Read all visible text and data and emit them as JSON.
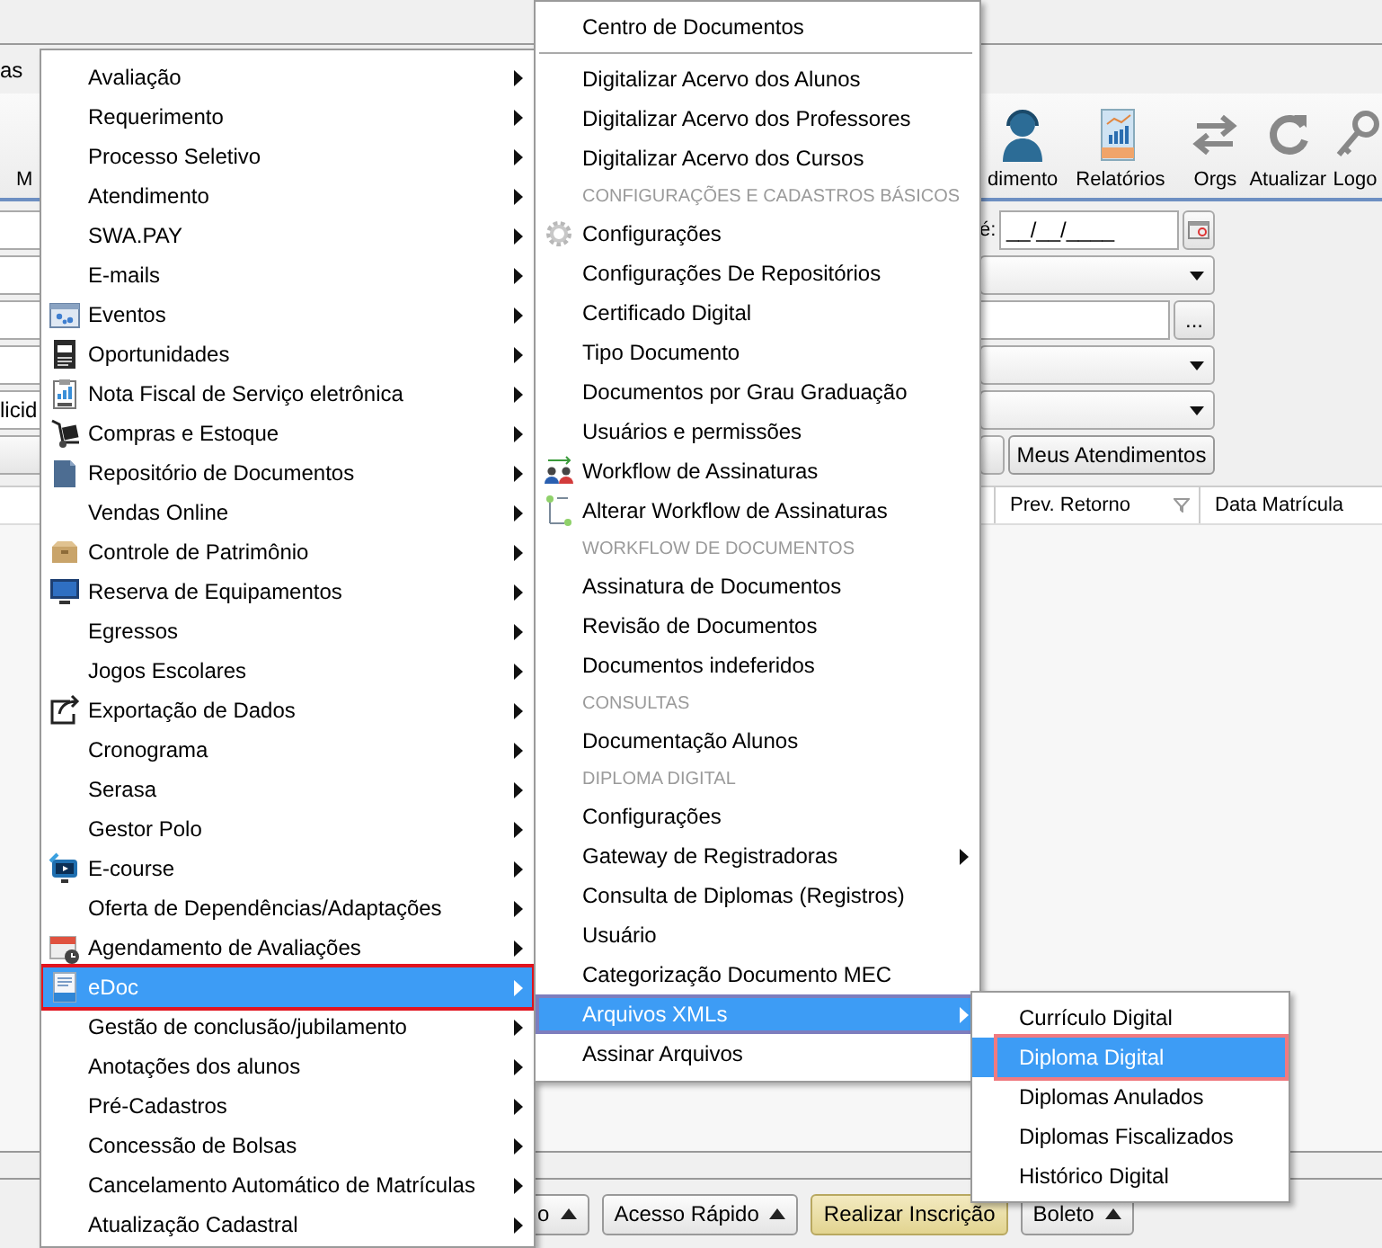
{
  "menu_bar": {
    "text": "as"
  },
  "toolbar": [
    {
      "label": "M"
    },
    {
      "label": "dimento"
    },
    {
      "label": "Relatórios"
    },
    {
      "label": "Orgs"
    },
    {
      "label": "Atualizar"
    },
    {
      "label": "Logo"
    }
  ],
  "form_rows": [
    {
      "kind": "date",
      "label": "é:",
      "value": "__/__/____"
    },
    {
      "kind": "dropdown"
    },
    {
      "kind": "lookup",
      "button": "..."
    },
    {
      "kind": "dropdown"
    },
    {
      "kind": "dropdown",
      "left_text": "licid"
    },
    {
      "kind": "buttons",
      "button": "Meus Atendimentos"
    }
  ],
  "table": {
    "columns": [
      {
        "label": "Prev. Retorno",
        "filter": true
      },
      {
        "label": "Data Matrícula",
        "filter": false
      }
    ]
  },
  "bottom_buttons": [
    {
      "label": "o",
      "kind": "menu"
    },
    {
      "label": "Acesso Rápido",
      "kind": "menu"
    },
    {
      "label": "Realizar Inscrição",
      "kind": "accent"
    },
    {
      "label": "Boleto",
      "kind": "menu"
    }
  ],
  "menus": [
    {
      "items": [
        {
          "kind": "item",
          "label": "Avaliação",
          "submenu": true,
          "selected": false,
          "marked": false
        },
        {
          "kind": "item",
          "label": "Requerimento",
          "submenu": true,
          "selected": false,
          "marked": false
        },
        {
          "kind": "item",
          "label": "Processo Seletivo",
          "submenu": true,
          "selected": false,
          "marked": false
        },
        {
          "kind": "item",
          "label": "Atendimento",
          "submenu": true,
          "selected": false,
          "marked": false
        },
        {
          "kind": "item",
          "label": "SWA.PAY",
          "submenu": true,
          "selected": false,
          "marked": false
        },
        {
          "kind": "item",
          "label": "E-mails",
          "submenu": true,
          "selected": false,
          "marked": false
        },
        {
          "kind": "item",
          "label": "Eventos",
          "submenu": true,
          "selected": false,
          "marked": false
        },
        {
          "kind": "item",
          "label": "Oportunidades",
          "submenu": true,
          "selected": false,
          "marked": false
        },
        {
          "kind": "item",
          "label": "Nota Fiscal de Serviço eletrônica",
          "submenu": true,
          "selected": false,
          "marked": false
        },
        {
          "kind": "item",
          "label": "Compras e Estoque",
          "submenu": true,
          "selected": false,
          "marked": false
        },
        {
          "kind": "item",
          "label": "Repositório de Documentos",
          "submenu": true,
          "selected": false,
          "marked": false
        },
        {
          "kind": "item",
          "label": "Vendas Online",
          "submenu": true,
          "selected": false,
          "marked": false
        },
        {
          "kind": "item",
          "label": "Controle de Patrimônio",
          "submenu": true,
          "selected": false,
          "marked": false
        },
        {
          "kind": "item",
          "label": "Reserva de Equipamentos",
          "submenu": true,
          "selected": false,
          "marked": false
        },
        {
          "kind": "item",
          "label": "Egressos",
          "submenu": true,
          "selected": false,
          "marked": false
        },
        {
          "kind": "item",
          "label": "Jogos Escolares",
          "submenu": true,
          "selected": false,
          "marked": false
        },
        {
          "kind": "item",
          "label": "Exportação de Dados",
          "submenu": true,
          "selected": false,
          "marked": false
        },
        {
          "kind": "item",
          "label": "Cronograma",
          "submenu": true,
          "selected": false,
          "marked": false
        },
        {
          "kind": "item",
          "label": "Serasa",
          "submenu": true,
          "selected": false,
          "marked": false
        },
        {
          "kind": "item",
          "label": "Gestor Polo",
          "submenu": true,
          "selected": false,
          "marked": false
        },
        {
          "kind": "item",
          "label": "E-course",
          "submenu": true,
          "selected": false,
          "marked": false
        },
        {
          "kind": "item",
          "label": "Oferta de Dependências/Adaptações",
          "submenu": true,
          "selected": false,
          "marked": false
        },
        {
          "kind": "item",
          "label": "Agendamento de Avaliações",
          "submenu": true,
          "selected": false,
          "marked": false
        },
        {
          "kind": "item",
          "label": "eDoc",
          "submenu": true,
          "selected": true,
          "marked": true
        },
        {
          "kind": "item",
          "label": "Gestão de conclusão/jubilamento",
          "submenu": true,
          "selected": false,
          "marked": false
        },
        {
          "kind": "item",
          "label": "Anotações dos alunos",
          "submenu": true,
          "selected": false,
          "marked": false
        },
        {
          "kind": "item",
          "label": "Pré-Cadastros",
          "submenu": true,
          "selected": false,
          "marked": false
        },
        {
          "kind": "item",
          "label": "Concessão de Bolsas",
          "submenu": true,
          "selected": false,
          "marked": false
        },
        {
          "kind": "item",
          "label": "Cancelamento Automático de Matrículas",
          "submenu": true,
          "selected": false,
          "marked": false
        },
        {
          "kind": "item",
          "label": "Atualização Cadastral",
          "submenu": true,
          "selected": false,
          "marked": false
        }
      ]
    },
    {
      "items": [
        {
          "kind": "item",
          "label": "Centro de Documentos",
          "submenu": false,
          "selected": false,
          "marked": false
        },
        {
          "kind": "separator"
        },
        {
          "kind": "item",
          "label": "Digitalizar Acervo dos Alunos",
          "submenu": false,
          "selected": false,
          "marked": false
        },
        {
          "kind": "item",
          "label": "Digitalizar Acervo dos Professores",
          "submenu": false,
          "selected": false,
          "marked": false
        },
        {
          "kind": "item",
          "label": "Digitalizar Acervo dos Cursos",
          "submenu": false,
          "selected": false,
          "marked": false
        },
        {
          "kind": "header",
          "label": "CONFIGURAÇÕES E CADASTROS BÁSICOS"
        },
        {
          "kind": "item",
          "label": "Configurações",
          "submenu": false,
          "selected": false,
          "marked": false
        },
        {
          "kind": "item",
          "label": "Configurações De Repositórios",
          "submenu": false,
          "selected": false,
          "marked": false
        },
        {
          "kind": "item",
          "label": "Certificado Digital",
          "submenu": false,
          "selected": false,
          "marked": false
        },
        {
          "kind": "item",
          "label": "Tipo Documento",
          "submenu": false,
          "selected": false,
          "marked": false
        },
        {
          "kind": "item",
          "label": "Documentos por Grau Graduação",
          "submenu": false,
          "selected": false,
          "marked": false
        },
        {
          "kind": "item",
          "label": "Usuários e permissões",
          "submenu": false,
          "selected": false,
          "marked": false
        },
        {
          "kind": "item",
          "label": "Workflow de Assinaturas",
          "submenu": false,
          "selected": false,
          "marked": false
        },
        {
          "kind": "item",
          "label": "Alterar Workflow de Assinaturas",
          "submenu": false,
          "selected": false,
          "marked": false
        },
        {
          "kind": "header",
          "label": "WORKFLOW DE DOCUMENTOS"
        },
        {
          "kind": "item",
          "label": "Assinatura de Documentos",
          "submenu": false,
          "selected": false,
          "marked": false
        },
        {
          "kind": "item",
          "label": "Revisão de Documentos",
          "submenu": false,
          "selected": false,
          "marked": false
        },
        {
          "kind": "item",
          "label": "Documentos indeferidos",
          "submenu": false,
          "selected": false,
          "marked": false
        },
        {
          "kind": "header",
          "label": "CONSULTAS"
        },
        {
          "kind": "item",
          "label": "Documentação Alunos",
          "submenu": false,
          "selected": false,
          "marked": false
        },
        {
          "kind": "header",
          "label": "DIPLOMA DIGITAL"
        },
        {
          "kind": "item",
          "label": "Configurações",
          "submenu": false,
          "selected": false,
          "marked": false
        },
        {
          "kind": "item",
          "label": "Gateway de Registradoras",
          "submenu": true,
          "selected": false,
          "marked": false
        },
        {
          "kind": "item",
          "label": "Consulta de Diplomas (Registros)",
          "submenu": false,
          "selected": false,
          "marked": false
        },
        {
          "kind": "item",
          "label": "Usuário",
          "submenu": false,
          "selected": false,
          "marked": false
        },
        {
          "kind": "item",
          "label": "Categorização Documento MEC",
          "submenu": false,
          "selected": false,
          "marked": false
        },
        {
          "kind": "item",
          "label": "Arquivos XMLs",
          "submenu": true,
          "selected": true,
          "marked": false
        },
        {
          "kind": "item",
          "label": "Assinar Arquivos",
          "submenu": false,
          "selected": false,
          "marked": false
        }
      ]
    },
    {
      "items": [
        {
          "kind": "item",
          "label": "Currículo Digital",
          "submenu": false,
          "selected": false,
          "marked": false
        },
        {
          "kind": "item",
          "label": "Diploma Digital",
          "submenu": false,
          "selected": true,
          "marked": true
        },
        {
          "kind": "item",
          "label": "Diplomas Anulados",
          "submenu": false,
          "selected": false,
          "marked": false
        },
        {
          "kind": "item",
          "label": "Diplomas Fiscalizados",
          "submenu": false,
          "selected": false,
          "marked": false
        },
        {
          "kind": "item",
          "label": "Histórico Digital",
          "submenu": false,
          "selected": false,
          "marked": false
        }
      ]
    }
  ]
}
